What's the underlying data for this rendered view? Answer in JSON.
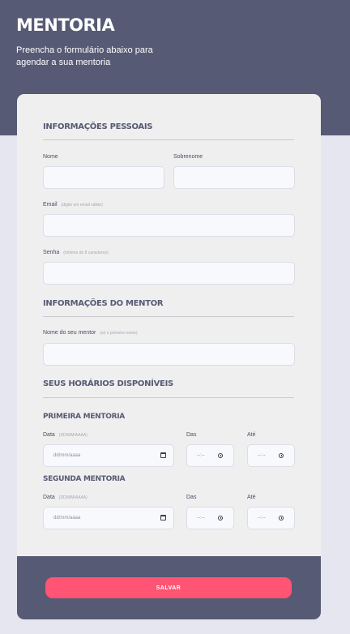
{
  "header": {
    "title": "MENTORIA",
    "subtitle": "Preencha o formulário abaixo para agendar a sua mentoria"
  },
  "personal": {
    "title": "INFORMAÇÕES PESSOAIS",
    "name_label": "Nome",
    "surname_label": "Sobrenome",
    "email_label": "Email",
    "email_hint": "(digite um email válido)",
    "password_label": "Senha",
    "password_hint": "(mínimo de 8 caracteres)"
  },
  "mentor": {
    "title": "INFORMAÇÕES DO MENTOR",
    "name_label": "Nome do seu mentor",
    "name_hint": "(só o primeiro nome)"
  },
  "schedule": {
    "title": "SEUS HORÁRIOS DISPONÍVEIS",
    "first": {
      "title": "PRIMEIRA MENTORIA",
      "date_label": "Data",
      "date_hint": "(DD/MM/AAAA)",
      "date_placeholder": "dd/mm/aaaa",
      "from_label": "Das",
      "to_label": "Até",
      "time_placeholder": "--:--"
    },
    "second": {
      "title": "SEGUNDA MENTORIA",
      "date_label": "Data",
      "date_hint": "(DD/MM/AAAA)",
      "date_placeholder": "dd/mm/aaaa",
      "from_label": "Das",
      "to_label": "Até",
      "time_placeholder": "--:--"
    }
  },
  "footer": {
    "save_label": "SALVAR"
  },
  "colors": {
    "header_bg": "#565a74",
    "page_bg": "#e6e6f0",
    "card_bg": "#efefef",
    "accent": "#ff5473"
  }
}
